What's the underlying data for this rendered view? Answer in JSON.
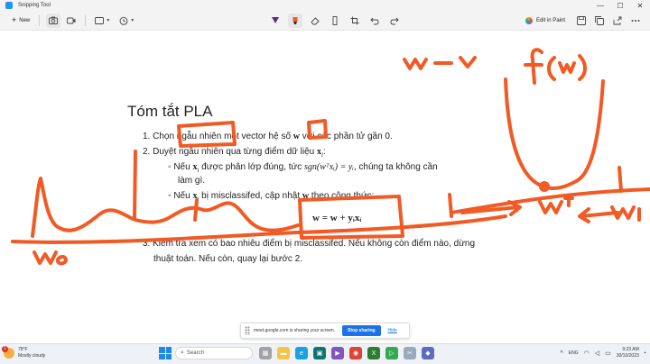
{
  "window": {
    "title": "Snipping Tool",
    "controls": {
      "minimize": "—",
      "maximize": "☐",
      "close": "✕"
    }
  },
  "toolbar": {
    "new_label": "New",
    "edit_in_paint_label": "Edit in Paint",
    "icons": [
      "camera-icon",
      "video-icon",
      "rectangle-mode-icon",
      "delay-timer-icon",
      "ballpoint-pen-icon",
      "highlighter-icon",
      "eraser-icon",
      "ruler-icon",
      "crop-icon",
      "undo-icon",
      "redo-icon",
      "save-icon",
      "copy-icon",
      "share-icon",
      "more-icon"
    ]
  },
  "slide": {
    "title": "Tóm tắt PLA",
    "item1": {
      "number": "1.",
      "text_before": "Chọn ngẫu nhiên một vector hệ số ",
      "bold_var": "w",
      "text_after": " với các phần tử gần 0."
    },
    "item2": {
      "number": "2.",
      "text": "Duyệt ngẫu nhiên qua từng điểm dữ liệu ",
      "var": "x",
      "sub": "i",
      "colon": ":"
    },
    "sub1": {
      "bullet": "◦",
      "t1": "Nếu ",
      "var": "x",
      "sub": "i",
      "t2": " được phân lớp đúng, tức ",
      "formula": "sgn(wᵀxᵢ) = yᵢ",
      "t3": ", chúng ta không cần",
      "line2": "làm gì."
    },
    "sub2": {
      "bullet": "◦",
      "t1": "Nếu ",
      "var": "x",
      "sub": "i",
      "t2": " bị misclassifed, cập nhật ",
      "bold_var": "w",
      "t3": " theo công thức:"
    },
    "update_formula": "w = w + yᵢxᵢ",
    "item3": {
      "number": "3.",
      "line1": "Kiểm tra xem có bao nhiêu điểm bị misclassifed. Nếu không còn điểm nào, dừng",
      "line2": "thuật toán. Nếu còn, quay lại bước 2."
    }
  },
  "handwriting": {
    "w0_left": "w₀",
    "top_right_left": "w – v",
    "top_right_fw": "f (w)",
    "wstar": "wᵀ",
    "w1": "w₁"
  },
  "ink_color": "#f15a24",
  "sharing_bar": {
    "message": "meet.google.com is sharing your screen.",
    "stop_label": "Stop sharing",
    "hide_label": "Hide"
  },
  "taskbar": {
    "weather_badge": "1",
    "temperature": "78°F",
    "condition": "Mostly cloudy",
    "search_placeholder": "Search",
    "language": "ENG",
    "time": "9:23 AM",
    "date": "30/10/2023"
  }
}
